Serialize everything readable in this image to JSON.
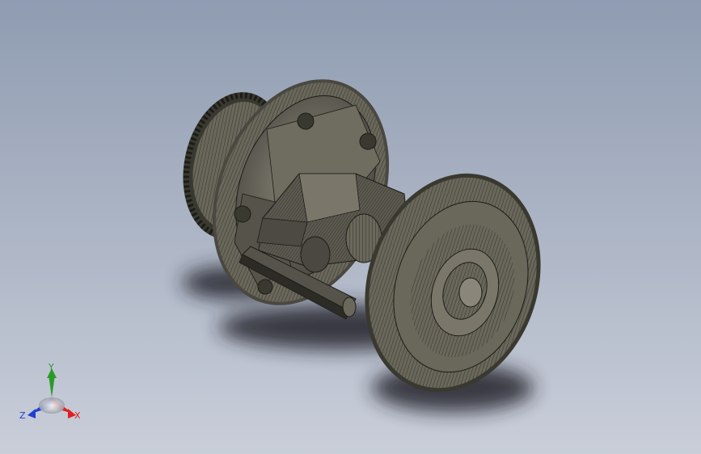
{
  "colors": {
    "background_top": "#8f9cb1",
    "background_bottom": "#c9ced9",
    "model_fill": "#5c5a50",
    "model_light": "#8a877a",
    "model_dark": "#1c1c18",
    "shadow": "#20242c",
    "axis_x": "#e02020",
    "axis_y": "#2a9a2a",
    "axis_z": "#2040d0"
  },
  "triad": {
    "x_label": "X",
    "y_label": "Y",
    "z_label": "Z"
  }
}
